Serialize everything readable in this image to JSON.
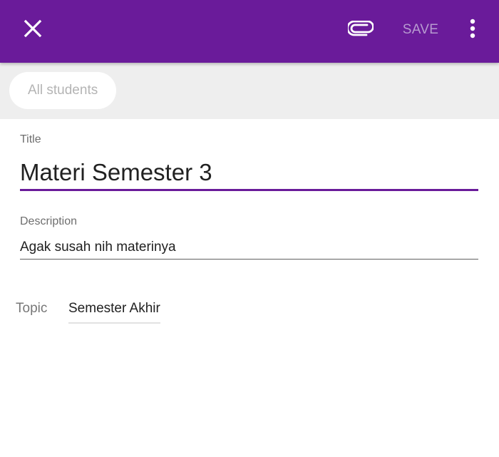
{
  "appbar": {
    "close_icon": "close-icon",
    "attach_icon": "attachment-icon",
    "save_label": "SAVE",
    "more_icon": "more-vert-icon",
    "background_color": "#6a1b9a",
    "save_color": "#b79ad0"
  },
  "recipients": {
    "chip_label": "All students"
  },
  "form": {
    "title_label": "Title",
    "title_value": "Materi Semester 3",
    "description_label": "Description",
    "description_value": "Agak susah nih materinya",
    "topic_label": "Topic",
    "topic_value": "Semester Akhir"
  }
}
